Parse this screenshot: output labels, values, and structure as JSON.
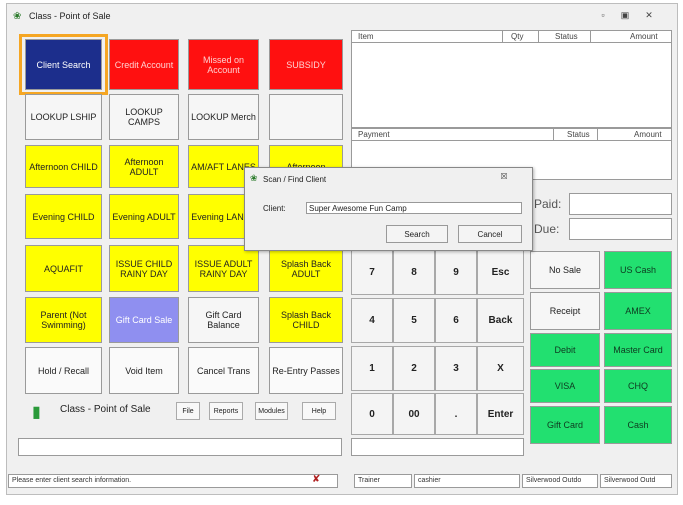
{
  "window": {
    "title": "Class - Point of Sale"
  },
  "icons": {
    "app": "leaf-icon",
    "minimize": "minimize-icon",
    "maximize": "maximize-icon",
    "close": "close-icon",
    "dialog": "leaf-icon",
    "logo": "card-icon",
    "status": "wrench-icon"
  },
  "buttons": {
    "client_search": "Client Search",
    "credit_account": "Credit Account",
    "missed_on_account": "Missed on Account",
    "subsidy": "SUBSIDY",
    "lookup_lship": "LOOKUP LSHIP",
    "lookup_camps": "LOOKUP CAMPS",
    "lookup_merch": "LOOKUP Merch",
    "afternoon_child": "Afternoon CHILD",
    "afternoon_adult": "Afternoon ADULT",
    "am_aft_lanes": "AM/AFT LANES",
    "afternoon_4": "Afternoon",
    "evening_child": "Evening CHILD",
    "evening_adult": "Evening ADULT",
    "evening_lanes": "Evening LANES",
    "aquafit": "AQUAFIT",
    "issue_child_rainy": "ISSUE CHILD RAINY DAY",
    "issue_adult_rainy": "ISSUE ADULT RAINY DAY",
    "splash_back_adult": "Splash Back ADULT",
    "parent_not_swimming": "Parent (Not Swimming)",
    "gift_card_sale": "Gift Card Sale",
    "gift_card_balance": "Gift Card Balance",
    "splash_back_child": "Splash Back CHILD",
    "hold_recall": "Hold / Recall",
    "void_item": "Void Item",
    "cancel_trans": "Cancel Trans",
    "re_entry_passes": "Re-Entry Passes"
  },
  "keypad": {
    "k7": "7",
    "k8": "8",
    "k9": "9",
    "esc": "Esc",
    "k4": "4",
    "k5": "5",
    "k6": "6",
    "back": "Back",
    "k1": "1",
    "k2": "2",
    "k3": "3",
    "x": "X",
    "k0": "0",
    "k00": "00",
    "dot": ".",
    "enter": "Enter"
  },
  "tender": {
    "no_sale": "No Sale",
    "us_cash": "US Cash",
    "receipt": "Receipt",
    "amex": "AMEX",
    "debit": "Debit",
    "master_card": "Master Card",
    "visa": "VISA",
    "chq": "CHQ",
    "gift_card": "Gift Card",
    "cash": "Cash"
  },
  "items_table": {
    "headers": [
      "Item",
      "Qty",
      "Status",
      "Amount"
    ]
  },
  "payment_table": {
    "headers": [
      "Payment",
      "Status",
      "Amount"
    ]
  },
  "totals": {
    "paid_label": "Paid:",
    "due_label": "Due:"
  },
  "logo_text": "Class - Point of Sale",
  "menu": {
    "file": "File",
    "reports": "Reports",
    "modules": "Modules",
    "help": "Help"
  },
  "dialog": {
    "title": "Scan / Find Client",
    "close": "☒",
    "client_label": "Client:",
    "client_value": "Super Awesome Fun Camp",
    "search": "Search",
    "cancel": "Cancel"
  },
  "status": {
    "message": "Please enter client search information.",
    "trainer": "Trainer",
    "user": "cashier",
    "site1": "Silverwood Outdo",
    "site2": "Silverwood Outd"
  },
  "colors": {
    "blue": "#1c2e8c",
    "red": "#ff1010",
    "yellow": "#ffff00",
    "green": "#22e070",
    "purple": "#8f8ff0",
    "highlight": "#f5a623"
  }
}
